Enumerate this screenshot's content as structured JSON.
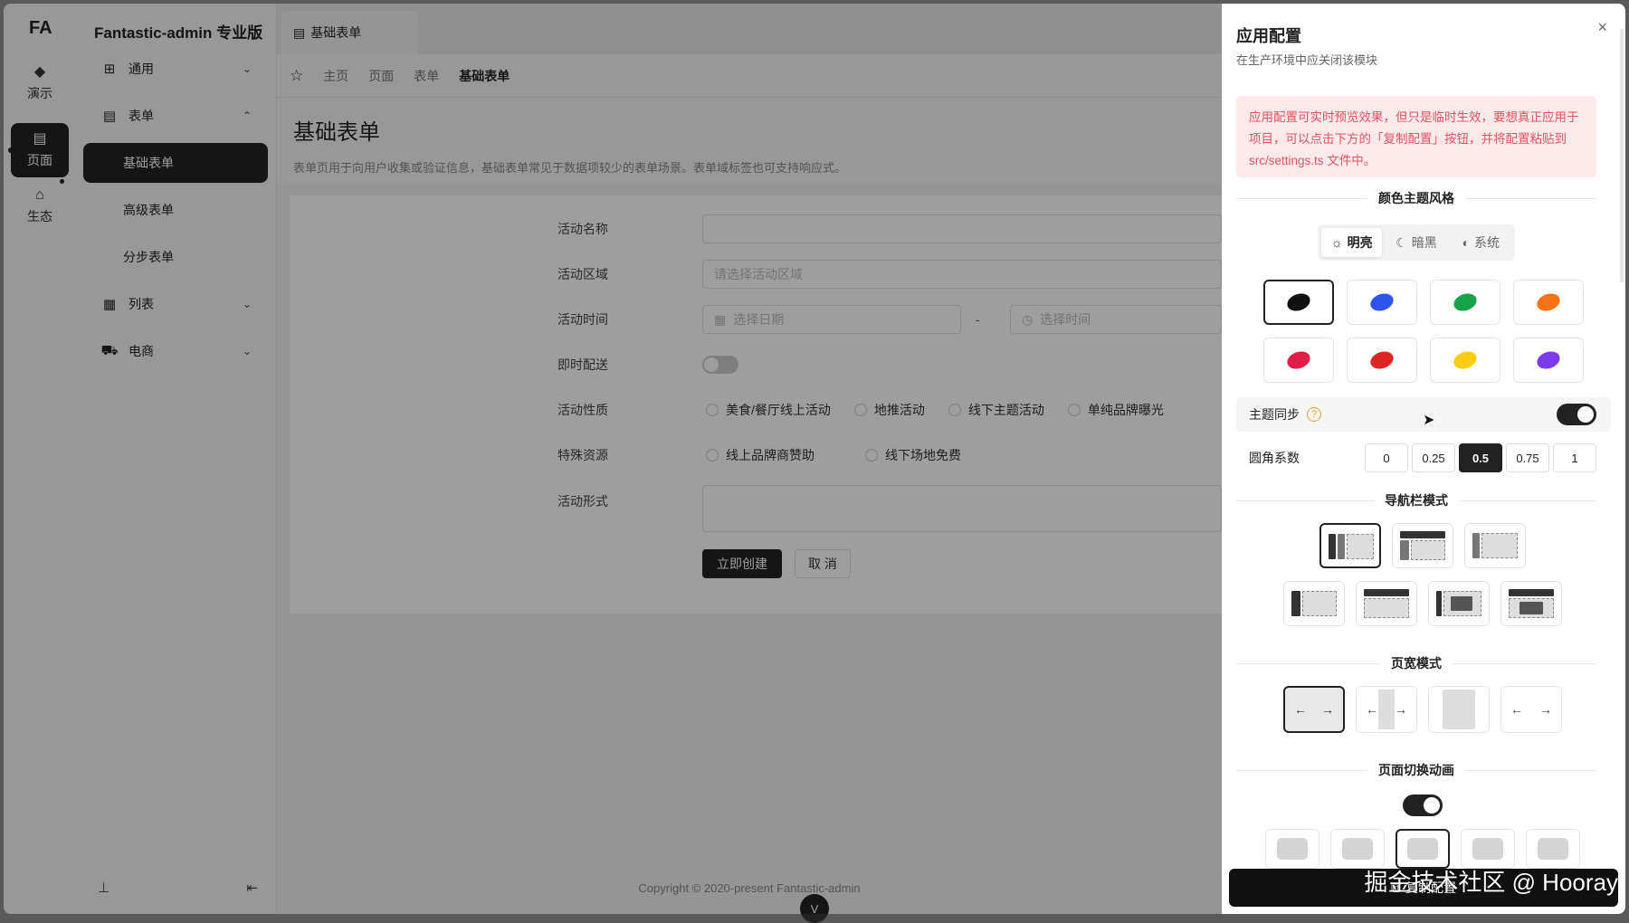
{
  "app": {
    "brand": "FA",
    "title": "Fantastic-admin 专业版"
  },
  "rail": [
    {
      "label": "演示",
      "icon": "cube-icon"
    },
    {
      "label": "页面",
      "icon": "page-icon"
    },
    {
      "label": "生态",
      "icon": "ecology-icon"
    }
  ],
  "menu": {
    "general": "通用",
    "forms": "表单",
    "basic": "基础表单",
    "advanced": "高级表单",
    "step": "分步表单",
    "list": "列表",
    "ecommerce": "电商"
  },
  "tab": {
    "label": "基础表单"
  },
  "breadcrumb": [
    "主页",
    "页面",
    "表单",
    "基础表单"
  ],
  "page": {
    "title": "基础表单",
    "description": "表单页用于向用户收集或验证信息，基础表单常见于数据项较少的表单场景。表单域标签也可支持响应式。"
  },
  "form": {
    "name_label": "活动名称",
    "region_label": "活动区域",
    "region_placeholder": "请选择活动区域",
    "time_label": "活动时间",
    "date_placeholder": "选择日期",
    "time_separator": "-",
    "time_placeholder": "选择时间",
    "delivery_label": "即时配送",
    "nature_label": "活动性质",
    "nature_options": [
      "美食/餐厅线上活动",
      "地推活动",
      "线下主题活动",
      "单纯品牌曝光"
    ],
    "resource_label": "特殊资源",
    "resource_options": [
      "线上品牌商赞助",
      "线下场地免费"
    ],
    "form_label": "活动形式",
    "submit": "立即创建",
    "cancel": "取 消"
  },
  "footer": {
    "copyright": "Copyright © 2020-present  Fantastic-admin"
  },
  "drawer": {
    "title": "应用配置",
    "subtitle": "在生产环境中应关闭该模块",
    "close": "×",
    "alert": "应用配置可实时预览效果，但只是临时生效，要想真正应用于项目，可以点击下方的「复制配置」按钮，并将配置粘贴到 src/settings.ts 文件中。",
    "color_section": "颜色主题风格",
    "theme_modes": [
      {
        "label": "明亮",
        "icon": "sun-icon",
        "selected": true
      },
      {
        "label": "暗黑",
        "icon": "moon-icon",
        "selected": false
      },
      {
        "label": "系统",
        "icon": "contrast-icon",
        "selected": false
      }
    ],
    "colors": [
      "#111111",
      "#2f54eb",
      "#16a34a",
      "#f97316",
      "#e11d48",
      "#dc2626",
      "#facc15",
      "#7c3aed"
    ],
    "theme_sync": "主题同步",
    "radius_label": "圆角系数",
    "radius_options": [
      "0",
      "0.25",
      "0.5",
      "0.75",
      "1"
    ],
    "radius_selected": "0.5",
    "nav_section": "导航栏模式",
    "width_section": "页宽模式",
    "anim_section": "页面切换动画",
    "copy_button": "复制配置"
  },
  "watermark": "掘金技术社区 @ Hooray"
}
